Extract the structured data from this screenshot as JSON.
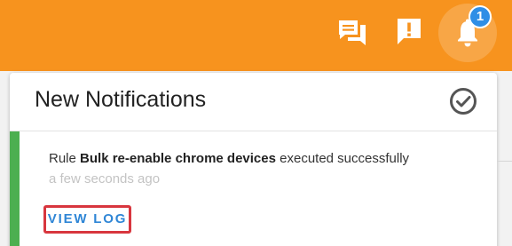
{
  "header": {
    "notification_count": "1",
    "bg_color": "#f7931e",
    "icons": [
      "chat-icon",
      "feedback-icon",
      "bell-icon"
    ]
  },
  "panel": {
    "title": "New Notifications",
    "mark_read_icon": "check-circle-icon"
  },
  "notification": {
    "prefix": "Rule ",
    "rule_name": "Bulk re-enable chrome devices",
    "suffix": " executed successfully",
    "time": "a few seconds ago",
    "action_label": "VIEW LOG",
    "status_color": "#4caf50",
    "action_color": "#2f86d6",
    "highlight_color": "#d8363e"
  }
}
